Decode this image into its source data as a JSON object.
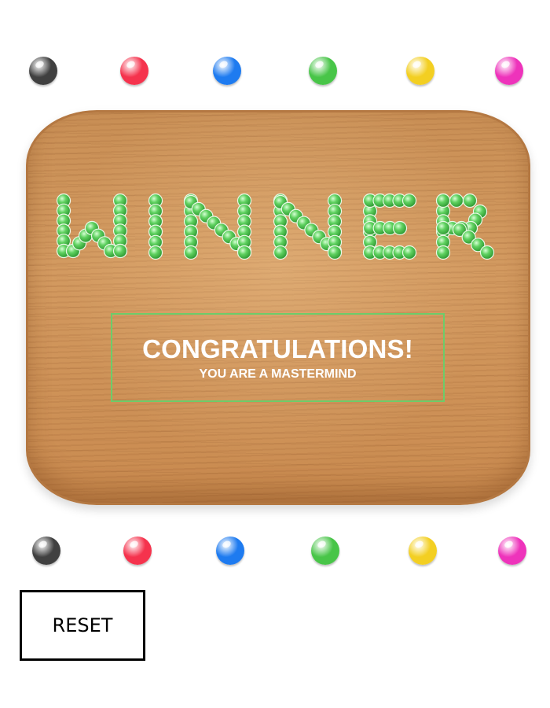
{
  "top_pegs": [
    {
      "color": "#404040",
      "name": "black"
    },
    {
      "color": "#f5334d",
      "name": "red"
    },
    {
      "color": "#1e7bf0",
      "name": "blue"
    },
    {
      "color": "#48c548",
      "name": "green"
    },
    {
      "color": "#f3cf22",
      "name": "yellow"
    },
    {
      "color": "#ee33bb",
      "name": "pink"
    }
  ],
  "bottom_pegs": [
    {
      "color": "#404040",
      "name": "black"
    },
    {
      "color": "#f5334d",
      "name": "red"
    },
    {
      "color": "#1e7bf0",
      "name": "blue"
    },
    {
      "color": "#48c548",
      "name": "green"
    },
    {
      "color": "#f3cf22",
      "name": "yellow"
    },
    {
      "color": "#ee33bb",
      "name": "pink"
    }
  ],
  "board": {
    "winner_word": "WINNER",
    "winner_peg_color": "#5fd160",
    "congrats_title": "CONGRATULATIONS!",
    "congrats_subtitle": "YOU ARE A MASTERMIND",
    "accent_color": "#6dcc6a"
  },
  "controls": {
    "reset_label": "RESET"
  }
}
